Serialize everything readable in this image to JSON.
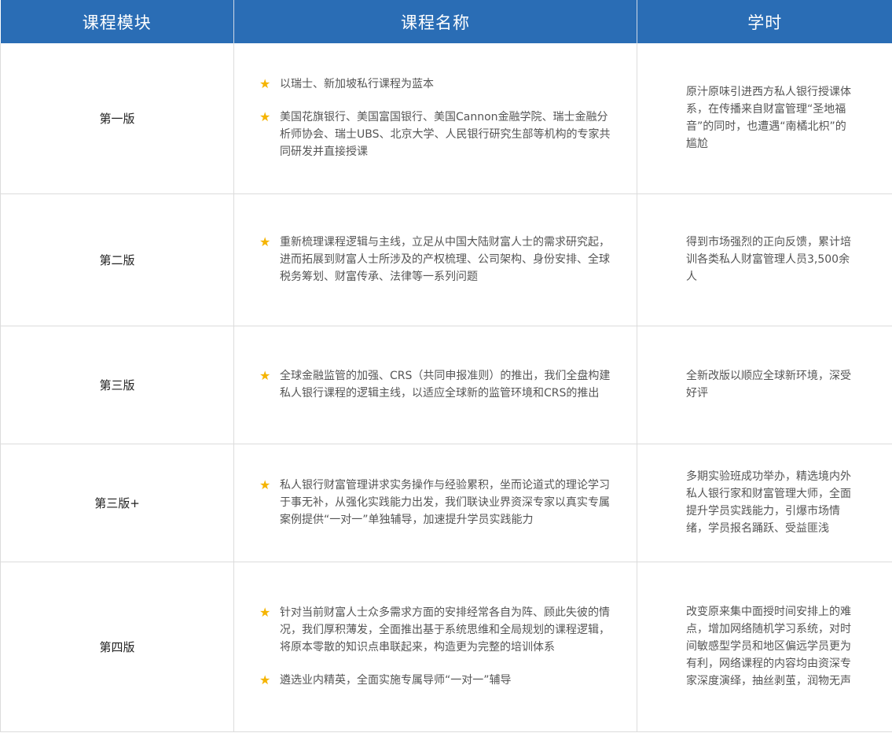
{
  "header": {
    "col_module": "课程模块",
    "col_name": "课程名称",
    "col_hours": "学时"
  },
  "rows": [
    {
      "module": "第一版",
      "points": [
        "以瑞士、新加坡私行课程为蓝本",
        "美国花旗银行、美国富国银行、美国Cannon金融学院、瑞士金融分析师协会、瑞士UBS、北京大学、人民银行研究生部等机构的专家共同研发并直接授课"
      ],
      "desc": "原汁原味引进西方私人银行授课体系，在传播来自财富管理“圣地福音”的同时，也遭遇“南橘北枳”的尴尬"
    },
    {
      "module": "第二版",
      "points": [
        "重新梳理课程逻辑与主线，立足从中国大陆财富人士的需求研究起，进而拓展到财富人士所涉及的产权梳理、公司架构、身份安排、全球税务筹划、财富传承、法律等一系列问题"
      ],
      "desc": "得到市场强烈的正向反馈，累计培训各类私人财富管理人员3,500余人"
    },
    {
      "module": "第三版",
      "points": [
        "全球金融监管的加强、CRS（共同申报准则）的推出，我们全盘构建私人银行课程的逻辑主线，以适应全球新的监管环境和CRS的推出"
      ],
      "desc": "全新改版以顺应全球新环境，深受好评"
    },
    {
      "module": "第三版+",
      "points": [
        "私人银行财富管理讲求实务操作与经验累积，坐而论道式的理论学习于事无补，从强化实践能力出发，我们联诀业界资深专家以真实专属案例提供“一对一”单独辅导，加速提升学员实践能力"
      ],
      "desc": "多期实验班成功举办，精选境内外私人银行家和财富管理大师，全面提升学员实践能力，引爆市场情绪，学员报名踊跃、受益匪浅"
    },
    {
      "module": "第四版",
      "points": [
        "针对当前财富人士众多需求方面的安排经常各自为阵、顾此失彼的情况，我们厚积薄发，全面推出基于系统思维和全局规划的课程逻辑，将原本零散的知识点串联起来，构造更为完整的培训体系",
        "遴选业内精英，全面实施专属导师“一对一”辅导"
      ],
      "desc": "改变原来集中面授时间安排上的难点，增加网络随机学习系统，对时间敏感型学员和地区偏远学员更为有利，网络课程的内容均由资深专家深度演绎，抽丝剥茧，润物无声"
    }
  ],
  "icons": {
    "bullet": "star-icon",
    "bullet_color": "#f5b400"
  },
  "colors": {
    "header_bg": "#2a6db5",
    "header_text": "#ffffff",
    "border": "#dcdcdc"
  }
}
